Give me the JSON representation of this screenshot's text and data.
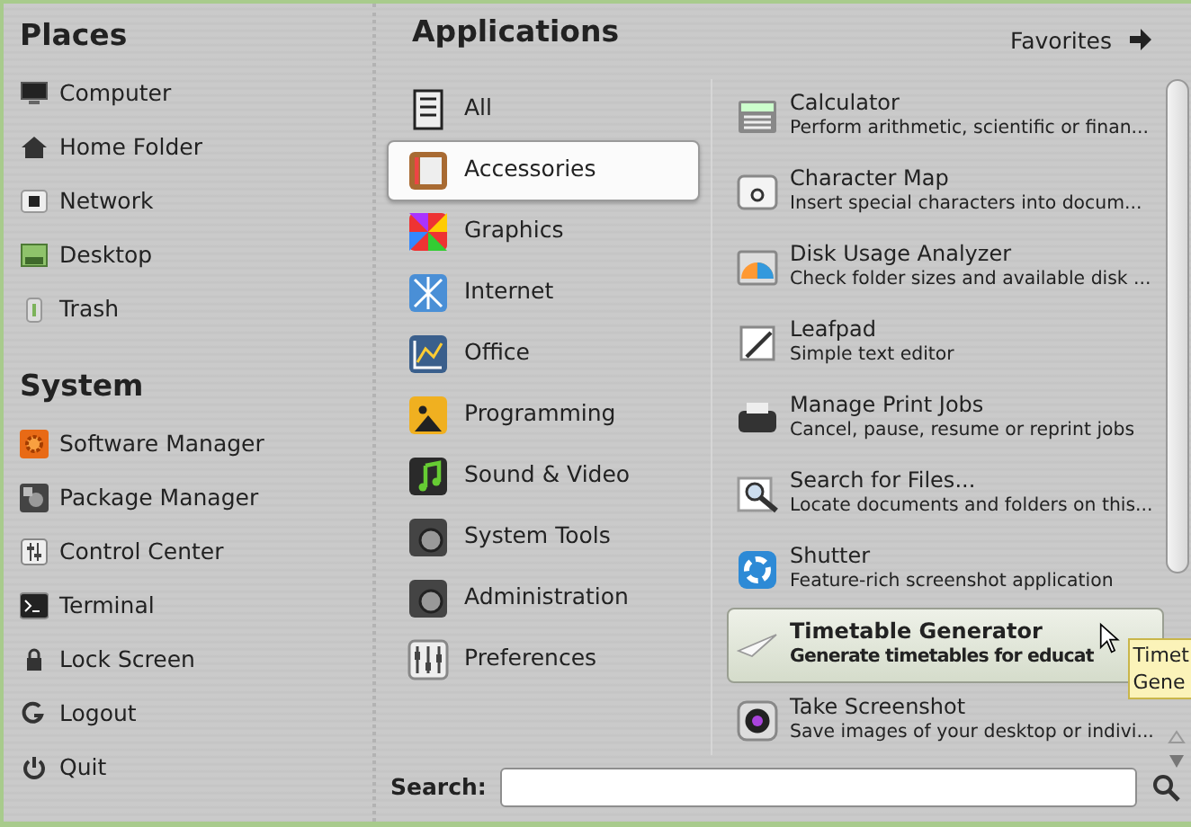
{
  "places": {
    "title": "Places",
    "items": [
      {
        "label": "Computer"
      },
      {
        "label": "Home Folder"
      },
      {
        "label": "Network"
      },
      {
        "label": "Desktop"
      },
      {
        "label": "Trash"
      }
    ]
  },
  "system": {
    "title": "System",
    "items": [
      {
        "label": "Software Manager"
      },
      {
        "label": "Package Manager"
      },
      {
        "label": "Control Center"
      },
      {
        "label": "Terminal"
      },
      {
        "label": "Lock Screen"
      },
      {
        "label": "Logout"
      },
      {
        "label": "Quit"
      }
    ]
  },
  "applications": {
    "title": "Applications",
    "favorites_link": "Favorites",
    "categories": [
      {
        "label": "All",
        "selected": false
      },
      {
        "label": "Accessories",
        "selected": true
      },
      {
        "label": "Graphics",
        "selected": false
      },
      {
        "label": "Internet",
        "selected": false
      },
      {
        "label": "Office",
        "selected": false
      },
      {
        "label": "Programming",
        "selected": false
      },
      {
        "label": "Sound & Video",
        "selected": false
      },
      {
        "label": "System Tools",
        "selected": false
      },
      {
        "label": "Administration",
        "selected": false
      },
      {
        "label": "Preferences",
        "selected": false
      }
    ],
    "apps": [
      {
        "name": "Calculator",
        "description": "Perform arithmetic, scientific or finan...",
        "hovered": false
      },
      {
        "name": "Character Map",
        "description": "Insert special characters into docum...",
        "hovered": false
      },
      {
        "name": "Disk Usage Analyzer",
        "description": "Check folder sizes and available disk ...",
        "hovered": false
      },
      {
        "name": "Leafpad",
        "description": "Simple text editor",
        "hovered": false
      },
      {
        "name": "Manage Print Jobs",
        "description": "Cancel, pause, resume or reprint jobs",
        "hovered": false
      },
      {
        "name": "Search for Files...",
        "description": "Locate documents and folders on this...",
        "hovered": false
      },
      {
        "name": "Shutter",
        "description": "Feature-rich screenshot application",
        "hovered": false
      },
      {
        "name": "Timetable Generator",
        "description": "Generate timetables for educat",
        "hovered": true
      },
      {
        "name": "Take Screenshot",
        "description": "Save images of your desktop or indivi...",
        "hovered": false
      }
    ]
  },
  "tooltip": {
    "lines": [
      "Timet",
      "Gene"
    ]
  },
  "search": {
    "label": "Search:"
  }
}
